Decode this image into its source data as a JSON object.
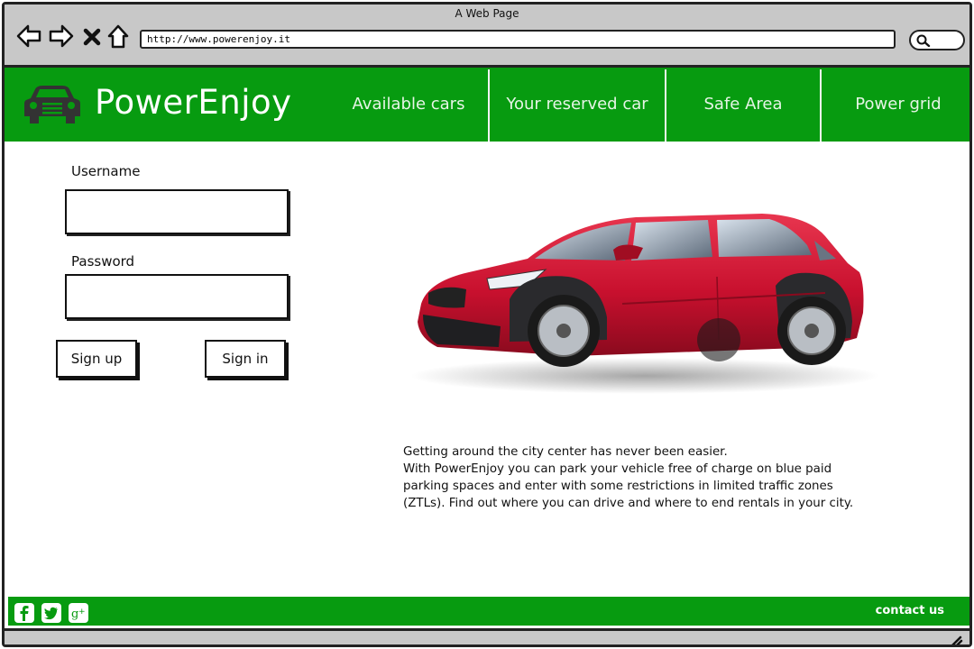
{
  "window": {
    "title": "A Web Page",
    "url": "http://www.powerenjoy.it"
  },
  "header": {
    "brand": "PowerEnjoy",
    "nav": [
      {
        "label": "Available cars"
      },
      {
        "label": "Your reserved car"
      },
      {
        "label": "Safe Area"
      },
      {
        "label": "Power grid"
      }
    ]
  },
  "login": {
    "username_label": "Username",
    "username_value": "",
    "password_label": "Password",
    "password_value": "",
    "signup_label": "Sign up",
    "signin_label": "Sign in"
  },
  "main": {
    "description_lines": [
      "Getting around the city center has never been easier.",
      "With PowerEnjoy you can park your vehicle free of charge on blue paid",
      "parking spaces and enter with some restrictions in limited traffic zones",
      "(ZTLs). Find out where you can drive and where to end rentals in your city."
    ]
  },
  "footer": {
    "social": [
      "facebook-icon",
      "twitter-icon",
      "google-plus-icon"
    ],
    "contact_label": "contact us"
  },
  "colors": {
    "brand_green": "#079b10",
    "chrome_gray": "#c8c8c8",
    "car_red": "#c8102e"
  }
}
